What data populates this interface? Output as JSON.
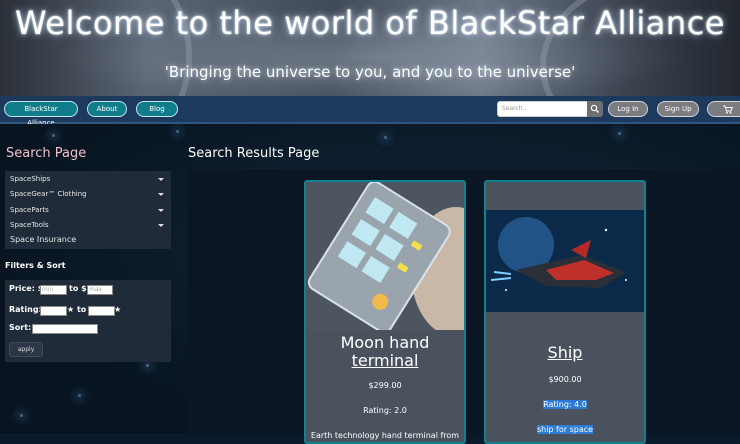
{
  "hero": {
    "title": "Welcome to the world of BlackStar Alliance",
    "tagline": "'Bringing the universe to you, and you to the universe'"
  },
  "nav": {
    "home": "BlackStar Alliance",
    "about": "About",
    "blog": "Blog",
    "search_placeholder": "Search..",
    "search_icon": "search-icon",
    "login": "Log In",
    "signup": "Sign Up",
    "cart_icon": "cart-icon"
  },
  "sidebar": {
    "title": "Search Page",
    "categories": [
      {
        "label": "SpaceShips"
      },
      {
        "label": "SpaceGear™ Clothing"
      },
      {
        "label": "SpaceParts"
      },
      {
        "label": "SpaceTools"
      },
      {
        "label": "Space Insurance"
      }
    ],
    "filters_title": "Filters & Sort",
    "price_label": "Price: $",
    "price_min_placeholder": "min",
    "price_to": "to $",
    "price_max_placeholder": "max",
    "rating_label": "Rating:",
    "rating_star": "★",
    "rating_to": "★ to",
    "sort_label": "Sort:",
    "apply": "apply"
  },
  "results": {
    "title": "Search Results Page",
    "cards": [
      {
        "name_line1": "Moon hand",
        "name_line2": "terminal",
        "price": "$299.00",
        "rating": "Rating: 2.0",
        "desc": "Earth technology hand terminal from"
      },
      {
        "name": "Ship",
        "price": "$900.00",
        "rating": "Rating: 4.0",
        "desc": "ship for space"
      }
    ]
  },
  "colors": {
    "accent": "#117d8b",
    "nav_bg": "#1d3a5c",
    "card_border": "#11818e",
    "highlight": "#2e7bd6"
  }
}
